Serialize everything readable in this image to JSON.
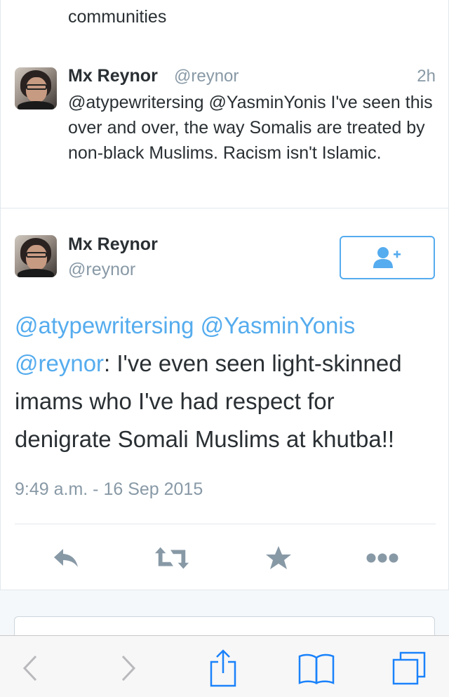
{
  "previous_tweet": {
    "tail_text": "communities"
  },
  "reply_tweet": {
    "name": "Mx Reynor",
    "handle": "@reynor",
    "time": "2h",
    "text": "@atypewritersing @YasminYonis I've seen this over and over, the way Somalis are treated by non-black Muslims. Racism isn't Islamic."
  },
  "main_tweet": {
    "name": "Mx Reynor",
    "handle": "@reynor",
    "follow_icon": "add-user-icon",
    "text_parts": {
      "mention1": "@atypewritersing",
      "space1": " ",
      "mention2": "@YasminYonis",
      "break1": " ",
      "mention3": "@reynor",
      "rest": ": I've even seen light-skinned imams who I've had respect for denigrate Somali Muslims at khutba!!"
    },
    "timestamp": "9:49 a.m. - 16 Sep 2015"
  },
  "actions": [
    {
      "icon": "reply-icon"
    },
    {
      "icon": "retweet-icon"
    },
    {
      "icon": "favorite-star-icon"
    },
    {
      "icon": "more-icon"
    }
  ],
  "colors": {
    "link": "#55acee",
    "muted": "#8899a6",
    "text": "#292f33",
    "safari_blue": "#1a82fb"
  },
  "safari_toolbar": [
    {
      "icon": "back-icon"
    },
    {
      "icon": "forward-icon"
    },
    {
      "icon": "share-icon"
    },
    {
      "icon": "bookmarks-icon"
    },
    {
      "icon": "tabs-icon"
    }
  ]
}
